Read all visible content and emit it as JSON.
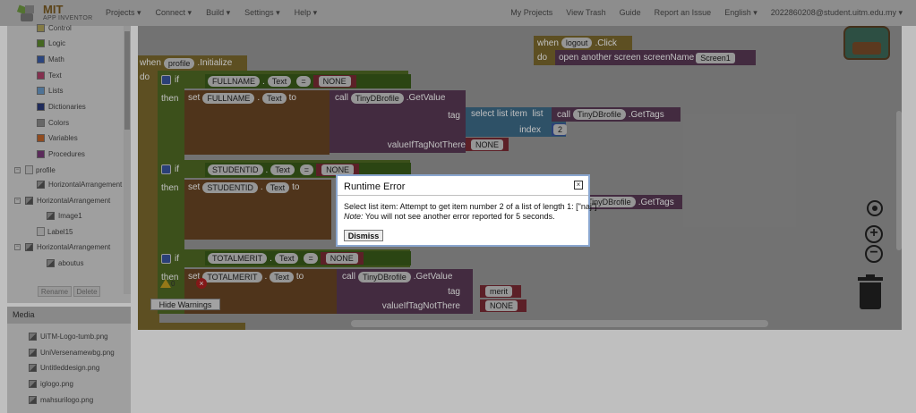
{
  "app": {
    "logo_title": "MIT",
    "logo_subtitle": "APP INVENTOR"
  },
  "menu_left": [
    "Projects ▾",
    "Connect ▾",
    "Build ▾",
    "Settings ▾",
    "Help ▾"
  ],
  "menu_right": [
    "My Projects",
    "View Trash",
    "Guide",
    "Report an Issue",
    "English ▾",
    "2022860208@student.uitm.edu.my ▾"
  ],
  "builtin_blocks": [
    "Control",
    "Logic",
    "Math",
    "Text",
    "Lists",
    "Dictionaries",
    "Colors",
    "Variables",
    "Procedures"
  ],
  "builtin_colors": [
    "#b0a45c",
    "#5d8a2c",
    "#3a5ca8",
    "#b0406a",
    "#6a9ac8",
    "#2a3a7a",
    "#8a8a8a",
    "#c0642a",
    "#7a3a7a"
  ],
  "component_tree": {
    "root": "profile",
    "items": [
      "HorizontalArrangement",
      "HorizontalArrangement",
      "Image1",
      "Label15",
      "HorizontalArrangement",
      "aboutus"
    ]
  },
  "panel_buttons": {
    "rename": "Rename",
    "delete": "Delete"
  },
  "media": {
    "header": "Media",
    "files": [
      "UiTM-Logo-tumb.png",
      "UniVersenamewbg.png",
      "Untitleddesign.png",
      "iglogo.png",
      "mahsurilogo.png"
    ]
  },
  "blocks": {
    "when": "when",
    "initialize_component": "profile",
    "initialize_event": ".Initialize",
    "do": "do",
    "if": "if",
    "then": "then",
    "set": "set",
    "to": "to",
    "call": "call",
    "dot": ".",
    "eq": "=",
    "text_prop": "Text",
    "fullname": "FULLNAME",
    "studentid": "STUDENTID",
    "totalmerit": "TOTALMERIT",
    "none_value": "NONE",
    "tinydb": "TinyDBrofile",
    "getvalue": ".GetValue",
    "gettags": ".GetTags",
    "tag_label": "tag",
    "select_list_item": "select list item",
    "list_label": "list",
    "index_label": "index",
    "index_value": "2",
    "value_if_missing": "valueIfTagNotThere",
    "merit_tag": "merit",
    "logout_when": "when",
    "logout_component": "logout",
    "logout_event": ".Click",
    "logout_do": "do",
    "open_screen": "open another screen  screenName",
    "screen_name": "Screen1"
  },
  "warnings": {
    "warn_count": "0",
    "error_count": "",
    "hide_label": "Hide Warnings"
  },
  "dialog": {
    "title": "Runtime Error",
    "message": "Select list item: Attempt to get item number 2 of a list of length 1: [\"naj\"]",
    "note_label": "Note:",
    "note_text": " You will not see another error reported for 5 seconds.",
    "dismiss": "Dismiss",
    "close_symbol": "×"
  }
}
